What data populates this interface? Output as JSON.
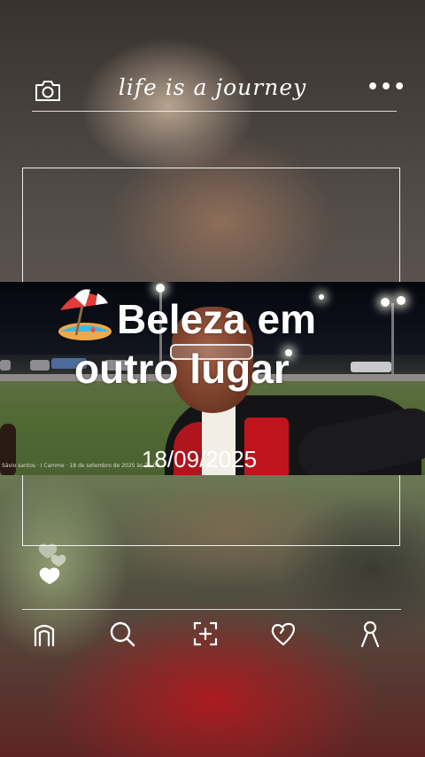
{
  "header": {
    "title": "life is a journey",
    "camera_icon": "camera-icon",
    "more_icon": "more-dots-icon",
    "more_label": "•••"
  },
  "post": {
    "headline_line1": "Beleza em",
    "headline_line2": "outro lugar",
    "emoji": "beach-umbrella",
    "date": "18/09/2025",
    "photo_caption": "Sávio santos · I Camme · 18 de setembro de 2025 às 21:09"
  },
  "reactions": {
    "icon": "hearts-icon"
  },
  "nav": {
    "items": [
      {
        "name": "home",
        "icon": "home-icon"
      },
      {
        "name": "search",
        "icon": "search-icon"
      },
      {
        "name": "add",
        "icon": "add-frame-icon"
      },
      {
        "name": "likes",
        "icon": "heart-icon"
      },
      {
        "name": "profile",
        "icon": "profile-icon"
      }
    ]
  },
  "colors": {
    "text": "#ffffff",
    "accent_red": "#c0141d"
  }
}
